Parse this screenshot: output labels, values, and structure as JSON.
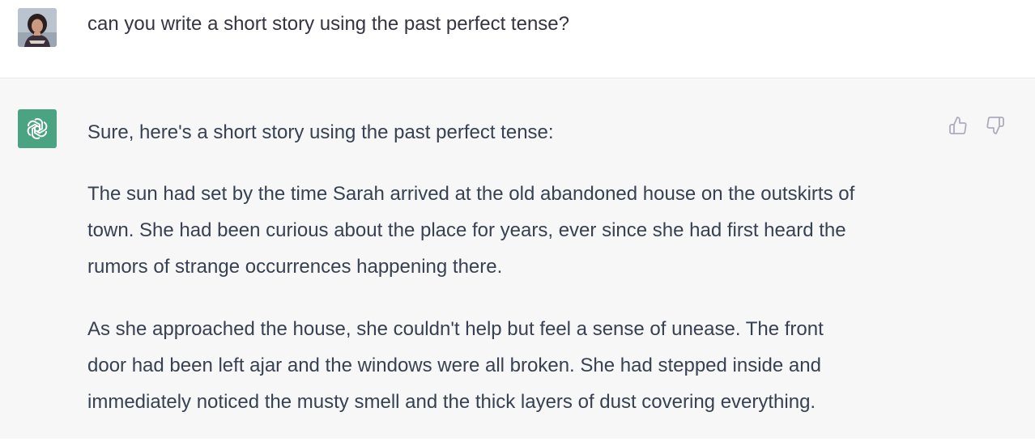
{
  "user_message": {
    "text": "can you write a short story using the past perfect tense?"
  },
  "assistant_message": {
    "intro": "Sure, here's a short story using the past perfect tense:",
    "paragraph_1": [
      "The sun had set by the time Sarah arrived at the old abandoned house on the outskirts of",
      "town. She had been curious about the place for years, ever since she had first heard the",
      "rumors of strange occurrences happening there."
    ],
    "paragraph_2": [
      "As she approached the house, she couldn't help but feel a sense of unease. The front",
      "door had been left ajar and the windows were all broken. She had stepped inside and",
      "immediately noticed the musty smell and the thick layers of dust covering everything."
    ]
  },
  "feedback": {
    "thumbs_up_icon": "thumbs-up-icon",
    "thumbs_down_icon": "thumbs-down-icon"
  },
  "colors": {
    "assistant_avatar": "#4aa383",
    "assistant_bg": "#f7f7f8",
    "text": "#374151",
    "icon": "#acacbe"
  }
}
